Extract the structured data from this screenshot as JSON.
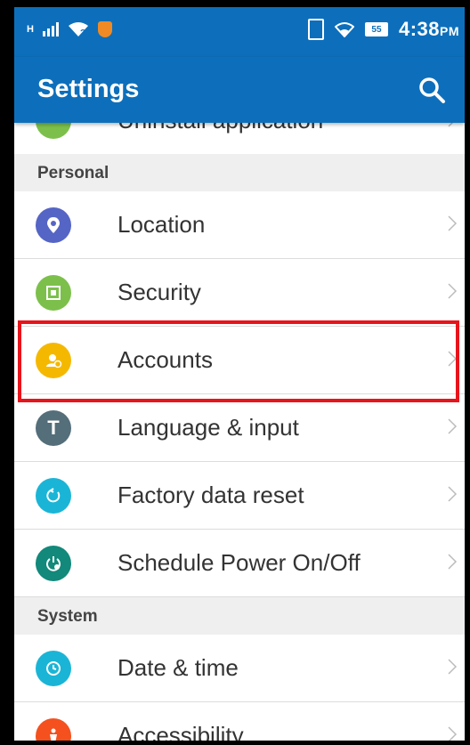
{
  "status_bar": {
    "signal_prefix": "H",
    "battery_level": "55",
    "time": "4:38",
    "time_suffix": "PM"
  },
  "app_bar": {
    "title": "Settings"
  },
  "partial_item": {
    "label": "Uninstall application"
  },
  "sections": [
    {
      "header": "Personal",
      "items": [
        {
          "label": "Location",
          "icon": "location-icon",
          "color": "#5565c5"
        },
        {
          "label": "Security",
          "icon": "security-icon",
          "color": "#7cc04b"
        },
        {
          "label": "Accounts",
          "icon": "accounts-icon",
          "color": "#f5b800"
        },
        {
          "label": "Language & input",
          "icon": "language-icon",
          "color": "#546e7a"
        },
        {
          "label": "Factory data reset",
          "icon": "reset-icon",
          "color": "#1ab5d6"
        },
        {
          "label": "Schedule Power On/Off",
          "icon": "power-schedule-icon",
          "color": "#12897a"
        }
      ]
    },
    {
      "header": "System",
      "items": [
        {
          "label": "Date & time",
          "icon": "clock-icon",
          "color": "#1ab5d6"
        },
        {
          "label": "Accessibility",
          "icon": "accessibility-icon",
          "color": "#f4511e"
        }
      ]
    }
  ],
  "colors": {
    "primary": "#0d6fbb",
    "highlight": "#e8141b"
  }
}
